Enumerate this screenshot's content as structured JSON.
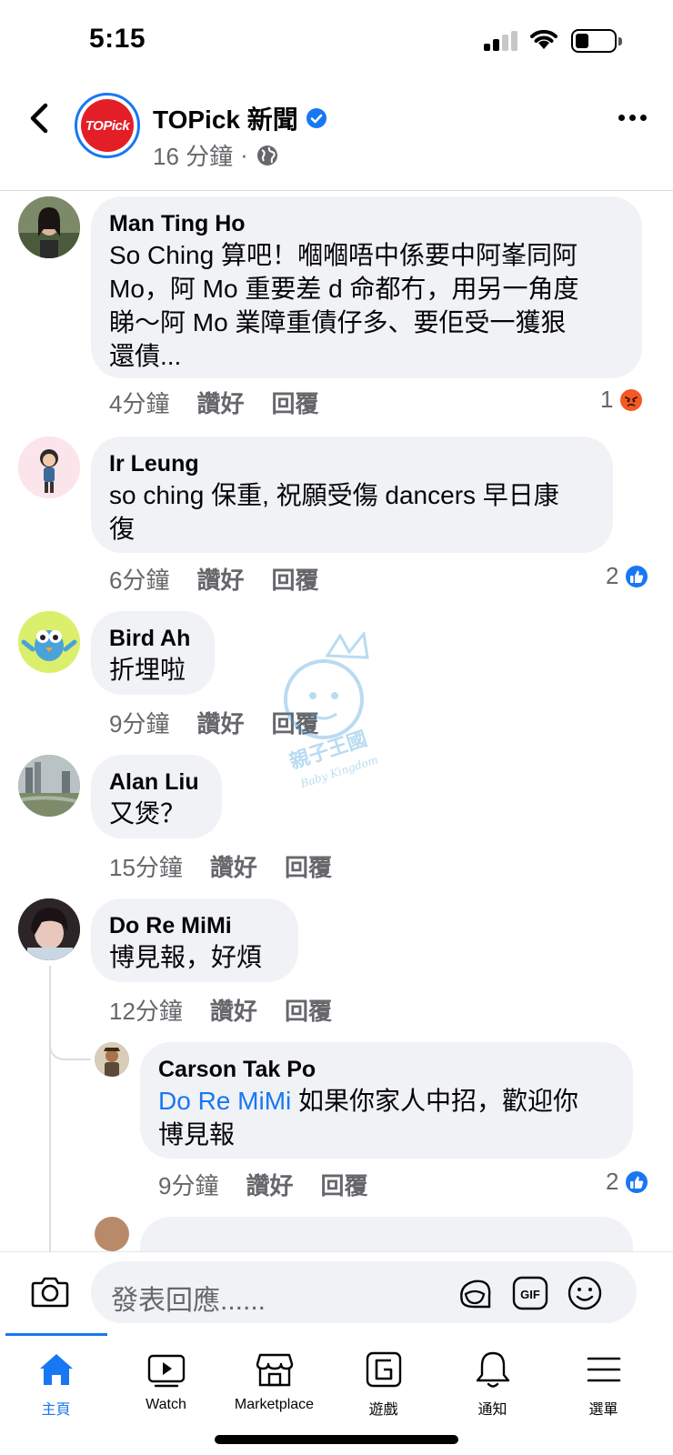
{
  "status_bar": {
    "time": "5:15",
    "battery_level": 0.35
  },
  "header": {
    "page_name": "TOPick 新聞",
    "time_ago": "16 分鐘",
    "separator": "·",
    "logo_text": "TOPick"
  },
  "comments": [
    {
      "author": "Man Ting Ho",
      "lines": [
        "So Ching 算吧！嗰嗰唔中係要中阿峯同阿",
        "Mo，阿 Mo 重要差 d 命都冇，用另一角度",
        "睇～阿 Mo 業障重債仔多、要佢受一獲狠",
        "還債..."
      ],
      "time": "4分鐘",
      "like": "讚好",
      "reply": "回覆",
      "reaction_count": "1",
      "reaction_type": "angry"
    },
    {
      "author": "Ir Leung",
      "lines": [
        "so ching 保重, 祝願受傷 dancers 早日康",
        "復"
      ],
      "time": "6分鐘",
      "like": "讚好",
      "reply": "回覆",
      "reaction_count": "2",
      "reaction_type": "like"
    },
    {
      "author": "Bird Ah",
      "lines": [
        "折埋啦"
      ],
      "time": "9分鐘",
      "like": "讚好",
      "reply": "回覆"
    },
    {
      "author": "Alan Liu",
      "lines": [
        "又煲？"
      ],
      "time": "15分鐘",
      "like": "讚好",
      "reply": "回覆"
    },
    {
      "author": "Do Re MiMi",
      "lines": [
        "博見報，好煩"
      ],
      "time": "12分鐘",
      "like": "讚好",
      "reply": "回覆"
    }
  ],
  "reply": {
    "author": "Carson Tak Po",
    "mention": "Do Re MiMi",
    "line1_rest": " 如果你家人中招，歡迎你",
    "line2": "博見報",
    "time": "9分鐘",
    "like": "讚好",
    "reply": "回覆",
    "reaction_count": "2",
    "reaction_type": "like"
  },
  "watermark": {
    "text_cn": "親子王國",
    "text_en": "Baby Kingdom"
  },
  "composer": {
    "placeholder": "發表回應......"
  },
  "tabs": [
    {
      "label": "主頁",
      "icon": "home-icon",
      "active": true
    },
    {
      "label": "Watch",
      "icon": "watch-icon",
      "active": false
    },
    {
      "label": "Marketplace",
      "icon": "marketplace-icon",
      "active": false
    },
    {
      "label": "遊戲",
      "icon": "gaming-icon",
      "active": false
    },
    {
      "label": "通知",
      "icon": "bell-icon",
      "active": false
    },
    {
      "label": "選單",
      "icon": "menu-icon",
      "active": false
    }
  ],
  "colors": {
    "accent": "#1877f2",
    "bubble": "#f0f2f5",
    "meta": "#65676b",
    "angry": "#f15a24"
  }
}
